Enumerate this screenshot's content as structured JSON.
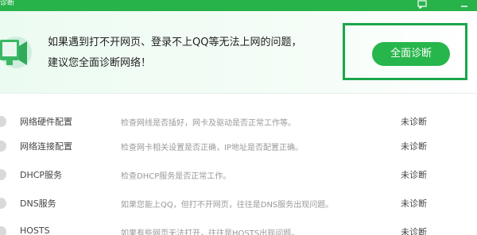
{
  "titlebar": {
    "title": "诊断",
    "feedback_icon": "feedback-icon",
    "minimize_icon": "minimize-icon",
    "color": "#27b24a"
  },
  "header": {
    "line1": "如果遇到打不开网页、登录不上QQ等无法上网的问题，",
    "line2": "建议您全面诊断网络！",
    "button_label": "全面诊断",
    "icon": "monitor-network-icon",
    "accent": "#27b64b",
    "highlight_color": "#1aa64a"
  },
  "items": [
    {
      "name": "网络硬件配置",
      "desc": "检查网线是否插好，网卡及驱动是否正常工作等。",
      "status": "未诊断"
    },
    {
      "name": "网络连接配置",
      "desc": "检查网卡相关设置是否正确，IP地址是否配置正确。",
      "status": "未诊断"
    },
    {
      "name": "DHCP服务",
      "desc": "检查DHCP服务是否正常工作。",
      "status": "未诊断"
    },
    {
      "name": "DNS服务",
      "desc": "如果您能上QQ，但打不开网页，往往是DNS服务出现问题。",
      "status": "未诊断"
    },
    {
      "name": "HOSTS",
      "desc": "如果有些网页无法打开，往往是HOSTS出现问题。",
      "status": "未诊断"
    }
  ]
}
